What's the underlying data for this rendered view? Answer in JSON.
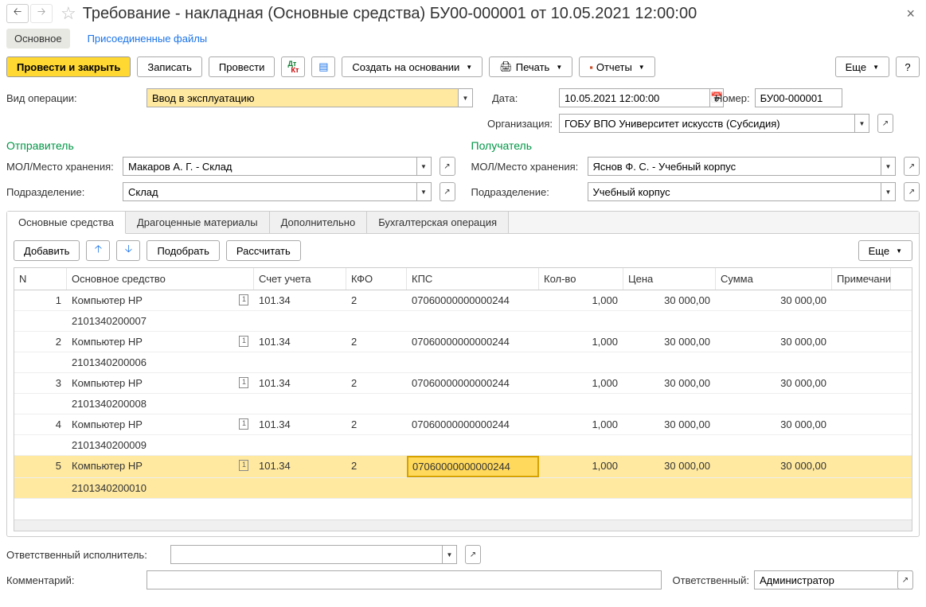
{
  "header": {
    "title": "Требование - накладная (Основные средства) БУ00-000001 от 10.05.2021 12:00:00"
  },
  "sections": {
    "main": "Основное",
    "files": "Присоединенные файлы"
  },
  "toolbar": {
    "post_close": "Провести и закрыть",
    "save": "Записать",
    "post": "Провести",
    "create_based": "Создать на основании",
    "print": "Печать",
    "reports": "Отчеты",
    "more": "Еще",
    "help": "?"
  },
  "form": {
    "op_type_label": "Вид операции:",
    "op_type_value": "Ввод в эксплуатацию",
    "date_label": "Дата:",
    "date_value": "10.05.2021 12:00:00",
    "number_label": "Номер:",
    "number_value": "БУ00-000001",
    "org_label": "Организация:",
    "org_value": "ГОБУ ВПО Университет искусств (Субсидия)",
    "sender_title": "Отправитель",
    "receiver_title": "Получатель",
    "mol_label": "МОЛ/Место хранения:",
    "sender_mol": "Макаров А. Г. - Склад",
    "receiver_mol": "Яснов Ф. С. - Учебный корпус",
    "dept_label": "Подразделение:",
    "sender_dept": "Склад",
    "receiver_dept": "Учебный корпус",
    "resp_exec_label": "Ответственный исполнитель:",
    "resp_exec_value": "",
    "comment_label": "Комментарий:",
    "comment_value": "",
    "responsible_label": "Ответственный:",
    "responsible_value": "Администратор"
  },
  "tabs": {
    "t1": "Основные средства",
    "t2": "Драгоценные материалы",
    "t3": "Дополнительно",
    "t4": "Бухгалтерская операция"
  },
  "table_toolbar": {
    "add": "Добавить",
    "pick": "Подобрать",
    "calc": "Рассчитать",
    "more": "Еще"
  },
  "table": {
    "headers": {
      "n": "N",
      "os": "Основное средство",
      "su": "Счет учета",
      "kfo": "КФО",
      "kps": "КПС",
      "kol": "Кол-во",
      "cena": "Цена",
      "sum": "Сумма",
      "prim": "Примечани"
    },
    "rows": [
      {
        "n": "1",
        "os": "Компьютер HP",
        "inv": "2101340200007",
        "su": "101.34",
        "kfo": "2",
        "kps": "07060000000000244",
        "kol": "1,000",
        "cena": "30 000,00",
        "sum": "30 000,00"
      },
      {
        "n": "2",
        "os": "Компьютер HP",
        "inv": "2101340200006",
        "su": "101.34",
        "kfo": "2",
        "kps": "07060000000000244",
        "kol": "1,000",
        "cena": "30 000,00",
        "sum": "30 000,00"
      },
      {
        "n": "3",
        "os": "Компьютер HP",
        "inv": "2101340200008",
        "su": "101.34",
        "kfo": "2",
        "kps": "07060000000000244",
        "kol": "1,000",
        "cena": "30 000,00",
        "sum": "30 000,00"
      },
      {
        "n": "4",
        "os": "Компьютер HP",
        "inv": "2101340200009",
        "su": "101.34",
        "kfo": "2",
        "kps": "07060000000000244",
        "kol": "1,000",
        "cena": "30 000,00",
        "sum": "30 000,00"
      },
      {
        "n": "5",
        "os": "Компьютер HP",
        "inv": "2101340200010",
        "su": "101.34",
        "kfo": "2",
        "kps": "07060000000000244",
        "kol": "1,000",
        "cena": "30 000,00",
        "sum": "30 000,00"
      }
    ]
  }
}
